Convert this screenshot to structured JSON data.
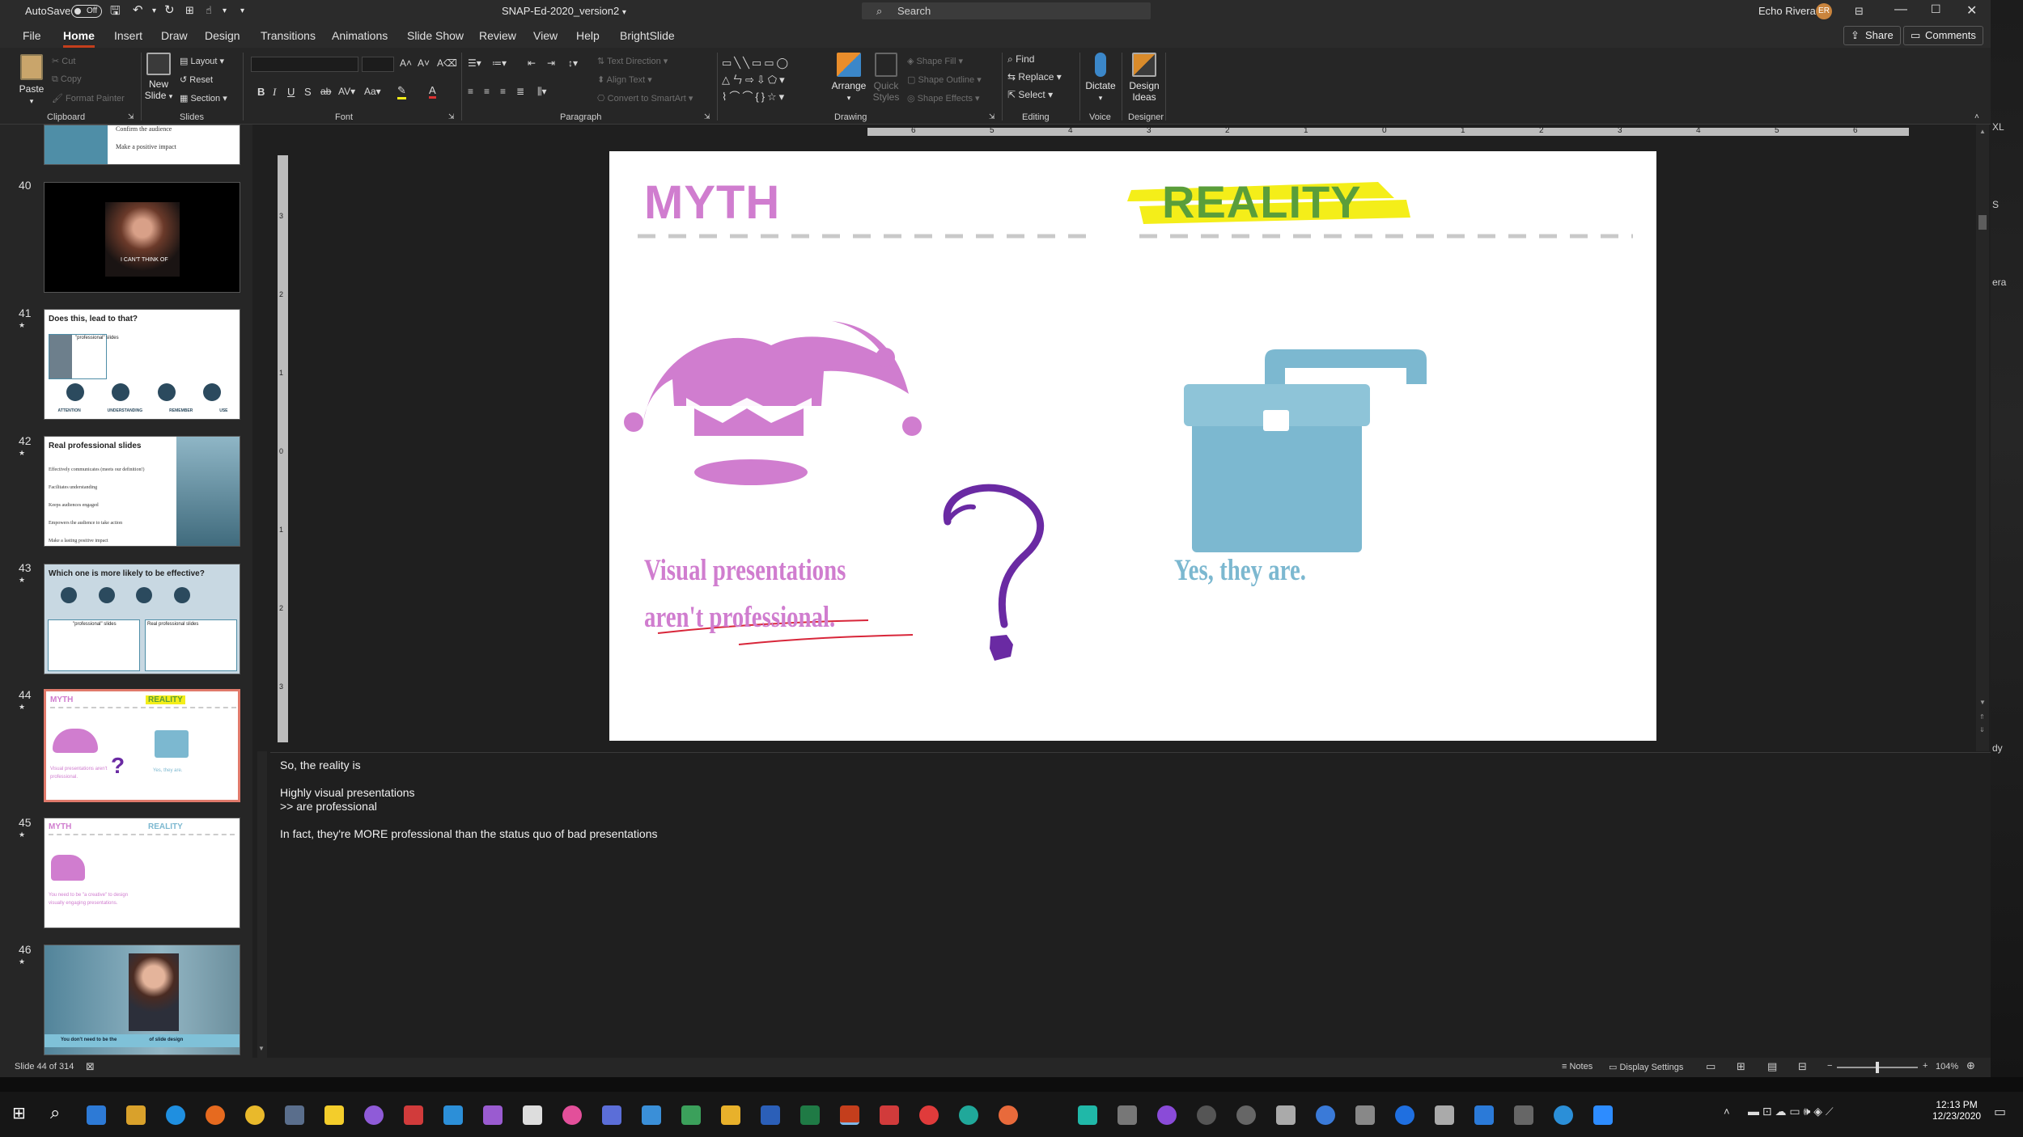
{
  "titlebar": {
    "autosave_label": "AutoSave",
    "autosave_state": "Off",
    "doc_title": "SNAP-Ed-2020_version2",
    "search_placeholder": "Search",
    "user_name": "Echo Rivera",
    "user_initials": "ER"
  },
  "tabs": [
    "File",
    "Home",
    "Insert",
    "Draw",
    "Design",
    "Transitions",
    "Animations",
    "Slide Show",
    "Review",
    "View",
    "Help",
    "BrightSlide"
  ],
  "active_tab": "Home",
  "share_label": "Share",
  "comments_label": "Comments",
  "ribbon": {
    "clipboard": {
      "group": "Clipboard",
      "paste": "Paste",
      "cut": "Cut",
      "copy": "Copy",
      "format_painter": "Format Painter"
    },
    "slides": {
      "group": "Slides",
      "new_slide": "New Slide",
      "layout": "Layout",
      "reset": "Reset",
      "section": "Section"
    },
    "font": {
      "group": "Font"
    },
    "paragraph": {
      "group": "Paragraph",
      "text_direction": "Text Direction",
      "align_text": "Align Text",
      "smartart": "Convert to SmartArt"
    },
    "drawing": {
      "group": "Drawing",
      "arrange": "Arrange",
      "quick_styles": "Quick Styles",
      "shape_fill": "Shape Fill",
      "shape_outline": "Shape Outline",
      "shape_effects": "Shape Effects"
    },
    "editing": {
      "group": "Editing",
      "find": "Find",
      "replace": "Replace",
      "select": "Select"
    },
    "voice": {
      "group": "Voice",
      "dictate": "Dictate"
    },
    "designer": {
      "group": "Designer",
      "design_ideas": "Design Ideas"
    }
  },
  "slide_numbers": [
    "40",
    "41",
    "42",
    "43",
    "44",
    "45",
    "46"
  ],
  "thumbs": {
    "t39_line1": "Confirm the audience",
    "t39_line2": "Make a positive impact",
    "t40_caption": "I CAN'T THINK OF",
    "t41_title": "Does this, lead to that?",
    "t41_box": "\"professional\" slides",
    "t42_title": "Real professional slides",
    "t42_lines": [
      "Effectively communicates (meets our definition!)",
      "Facilitates understanding",
      "Keeps audiences engaged",
      "Empowers the audience to take action",
      "Make a lasting positive impact"
    ],
    "t43_title": "Which one is more likely to be effective?",
    "t43_box1": "\"professional\" slides",
    "t43_box2": "Real professional slides",
    "labels4": [
      "ATTENTION",
      "UNDERSTANDING",
      "REMEMBER",
      "USE"
    ],
    "t44_myth": "MYTH",
    "t44_reality": "REALITY",
    "t44_left": "Visual presentations aren't professional.",
    "t44_right": "Yes, they are.",
    "t45_myth": "MYTH",
    "t45_reality": "REALITY",
    "t45_text": "You need to be \"a creative\" to design visually engaging presentations.",
    "t46_caption_a": "You don't need to be the",
    "t46_caption_b": "of slide design"
  },
  "slide": {
    "myth": "MYTH",
    "reality": "REALITY",
    "left_statement": "Visual presentations aren't professional.",
    "right_statement": "Yes, they are."
  },
  "ruler_h": [
    "6",
    "5",
    "4",
    "3",
    "2",
    "1",
    "0",
    "1",
    "2",
    "3",
    "4",
    "5",
    "6"
  ],
  "ruler_v": [
    "3",
    "2",
    "1",
    "0",
    "1",
    "2",
    "3"
  ],
  "notes": [
    "So, the reality is",
    "Highly visual presentations",
    ">> are professional",
    "In fact, they're MORE professional than the status quo of bad presentations"
  ],
  "status": {
    "slide_info": "Slide 44 of 314",
    "notes": "Notes",
    "display_settings": "Display Settings",
    "zoom": "104%"
  },
  "clock": {
    "time": "12:13 PM",
    "date": "12/23/2020"
  },
  "colors": {
    "myth": "#d07dcf",
    "reality_text": "#5a9e3a",
    "highlight": "#f4ee19",
    "blue": "#7cb8d0",
    "question": "#6a2aa3",
    "underline": "#d8263a"
  }
}
